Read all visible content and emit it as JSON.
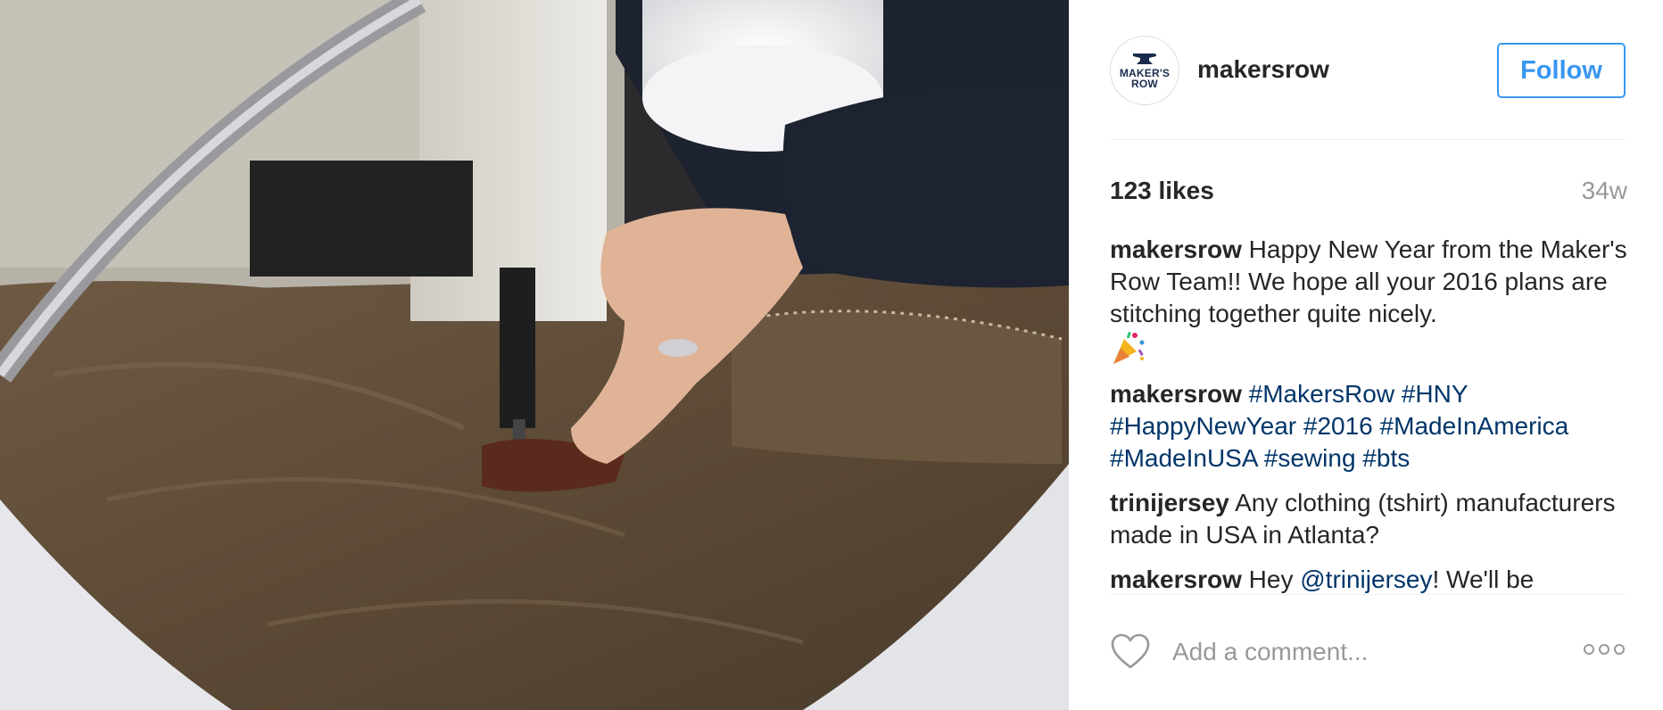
{
  "post": {
    "image_alt": "Hand guiding waxed canvas under an industrial sewing machine",
    "avatar_text_1": "MAKER'S",
    "avatar_text_2": "ROW",
    "username": "makersrow",
    "follow_label": "Follow",
    "likes": "123 likes",
    "time": "34w"
  },
  "comments": [
    {
      "author": "makersrow",
      "text": "Happy New Year from the Maker's Row Team!! We hope all your 2016 plans are stitching together quite nicely.",
      "emoji": "party-popper"
    },
    {
      "author": "makersrow",
      "tags": [
        "#MakersRow",
        "#HNY",
        "#HappyNewYear",
        "#2016",
        "#MadeInAmerica",
        "#MadeInUSA",
        "#sewing",
        "#bts"
      ]
    },
    {
      "author": "trinijersey",
      "text": "Any clothing (tshirt) manufacturers made in USA in Atlanta?"
    },
    {
      "author": "makersrow",
      "text_before": "Hey",
      "mention": "@trinijersey",
      "text_after": "! We'll be"
    }
  ],
  "footer": {
    "comment_placeholder": "Add a comment...",
    "like_icon": "heart-icon",
    "more_icon": "more-options-icon"
  },
  "colors": {
    "follow_blue": "#3897f0",
    "hashtag": "#003569",
    "muted": "#999999",
    "text": "#262626"
  }
}
